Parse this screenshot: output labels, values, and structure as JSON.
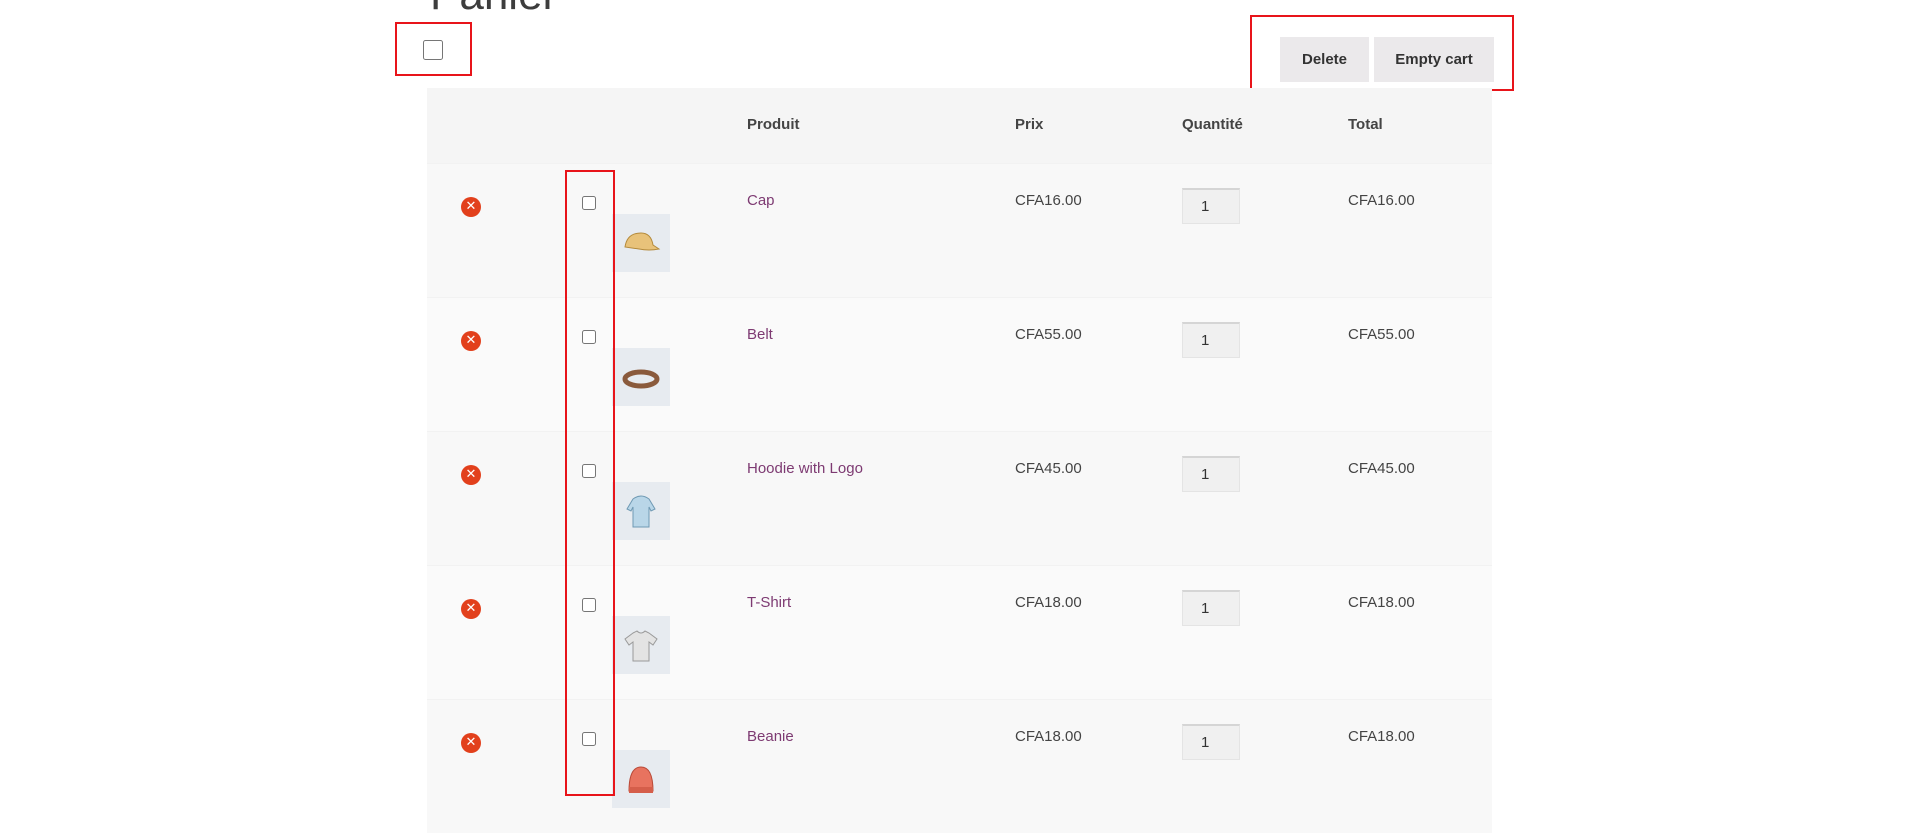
{
  "page_title": "Panier",
  "actions": {
    "delete_label": "Delete",
    "empty_cart_label": "Empty cart"
  },
  "table": {
    "headers": {
      "product": "Produit",
      "price": "Prix",
      "quantity": "Quantité",
      "total": "Total"
    },
    "rows": [
      {
        "name": "Cap",
        "price": "CFA16.00",
        "quantity": "1",
        "total": "CFA16.00",
        "icon": "cap-icon"
      },
      {
        "name": "Belt",
        "price": "CFA55.00",
        "quantity": "1",
        "total": "CFA55.00",
        "icon": "belt-icon"
      },
      {
        "name": "Hoodie with Logo",
        "price": "CFA45.00",
        "quantity": "1",
        "total": "CFA45.00",
        "icon": "hoodie-icon"
      },
      {
        "name": "T-Shirt",
        "price": "CFA18.00",
        "quantity": "1",
        "total": "CFA18.00",
        "icon": "tshirt-icon"
      },
      {
        "name": "Beanie",
        "price": "CFA18.00",
        "quantity": "1",
        "total": "CFA18.00",
        "icon": "beanie-icon"
      }
    ]
  },
  "colors": {
    "accent_link": "#7d3a72",
    "remove": "#e2401c",
    "highlight": "#e8141a"
  }
}
